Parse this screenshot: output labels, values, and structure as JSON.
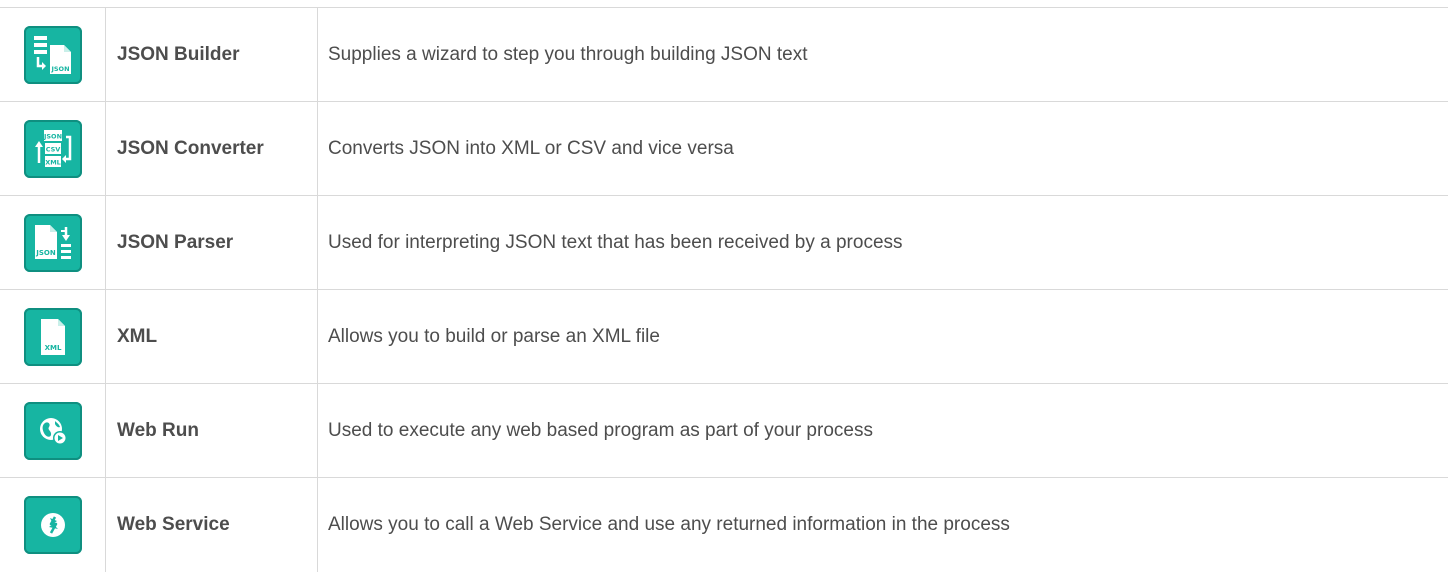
{
  "colors": {
    "tile": "#17b5a2",
    "tile_border": "#0f8f80",
    "grid": "#d9d9d9",
    "text": "#4d4d4d"
  },
  "rows": [
    {
      "icon": "json-builder-icon",
      "name": "JSON Builder",
      "description": "Supplies a wizard to step you through building JSON text",
      "icon_label": "JSON"
    },
    {
      "icon": "json-converter-icon",
      "name": "JSON Converter",
      "description": "Converts JSON into XML or CSV and vice versa",
      "icon_labels": [
        "JSON",
        "CSV",
        "XML"
      ]
    },
    {
      "icon": "json-parser-icon",
      "name": "JSON Parser",
      "description": "Used for interpreting JSON text that has been received by a process",
      "icon_label": "JSON"
    },
    {
      "icon": "xml-file-icon",
      "name": "XML",
      "description": "Allows you to build or parse an XML file",
      "icon_label": "XML"
    },
    {
      "icon": "web-run-icon",
      "name": "Web Run",
      "description": "Used to execute any web based program as part of your process"
    },
    {
      "icon": "web-service-icon",
      "name": "Web Service",
      "description": "Allows you to call a Web Service and use any returned information in the process"
    }
  ]
}
